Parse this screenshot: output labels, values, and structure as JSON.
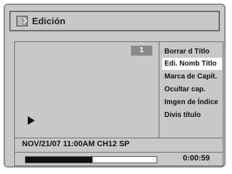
{
  "header": {
    "title": "Edición",
    "icon": "edit-icon"
  },
  "preview": {
    "chapter_number": "1",
    "play_icon": "play-icon"
  },
  "menu": {
    "items": [
      {
        "label": "Borrar d Títlo",
        "selected": false
      },
      {
        "label": "Edi. Nomb Títlo",
        "selected": true
      },
      {
        "label": "Marca de Capít.",
        "selected": false
      },
      {
        "label": "Ocultar cap.",
        "selected": false
      },
      {
        "label": "Imgen de Índice",
        "selected": false
      },
      {
        "label": "Divis título",
        "selected": false
      }
    ]
  },
  "info": {
    "recording_info": "NOV/21/07 11:00AM CH12 SP"
  },
  "playback": {
    "elapsed_time": "0:00:59",
    "progress_fraction": 0.51
  },
  "colors": {
    "panel": "#c8c8c8",
    "selected": "#ffffff",
    "badge": "#8a8a8a"
  }
}
